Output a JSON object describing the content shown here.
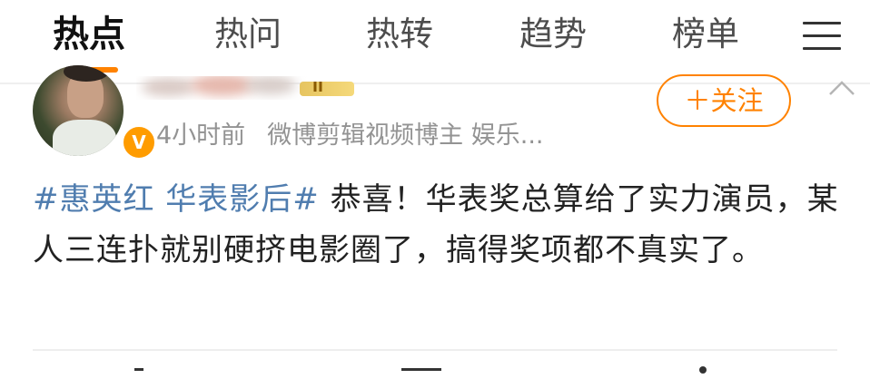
{
  "tabs": [
    {
      "label": "热点",
      "active": true
    },
    {
      "label": "热问",
      "active": false
    },
    {
      "label": "热转",
      "active": false
    },
    {
      "label": "趋势",
      "active": false
    },
    {
      "label": "榜单",
      "active": false
    }
  ],
  "menu_icon": "hamburger-menu-icon",
  "post": {
    "time": "4小时前",
    "source": "微博剪辑视频博主 娱乐...",
    "follow_label": "＋关注",
    "badge_icon": "verified-v-icon",
    "hashtag": "#惠英红 华表影后#",
    "text": " 恭喜！华表奖总算给了实力演员，某人三连扑就别硬挤电影圈了，搞得奖项都不真实了。"
  },
  "colors": {
    "accent": "#ff8200",
    "hashtag": "#507daf",
    "meta_text": "#939393",
    "body_text": "#222222"
  }
}
